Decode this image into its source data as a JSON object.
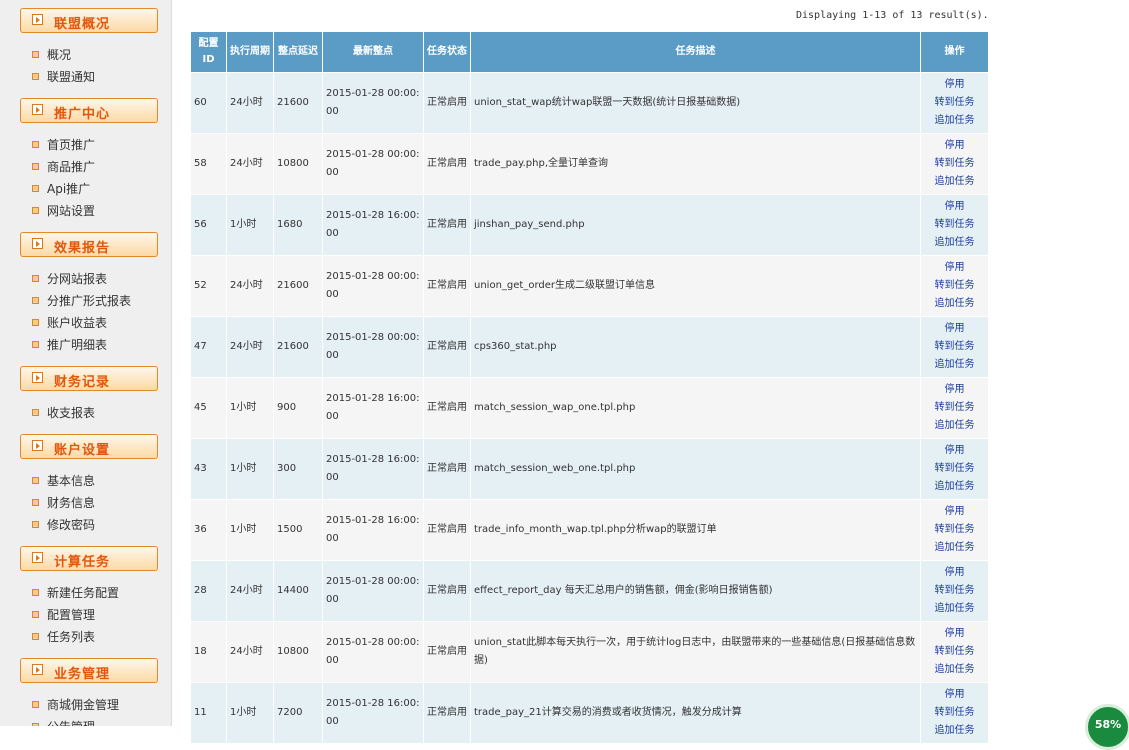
{
  "sidebar": {
    "sections": [
      {
        "title": "联盟概况",
        "items": [
          "概况",
          "联盟通知"
        ]
      },
      {
        "title": "推广中心",
        "items": [
          "首页推广",
          "商品推广",
          "Api推广",
          "网站设置"
        ]
      },
      {
        "title": "效果报告",
        "items": [
          "分网站报表",
          "分推广形式报表",
          "账户收益表",
          "推广明细表"
        ]
      },
      {
        "title": "财务记录",
        "items": [
          "收支报表"
        ]
      },
      {
        "title": "账户设置",
        "items": [
          "基本信息",
          "财务信息",
          "修改密码"
        ]
      },
      {
        "title": "计算任务",
        "items": [
          "新建任务配置",
          "配置管理",
          "任务列表"
        ]
      },
      {
        "title": "业务管理",
        "items": [
          "商城佣金管理",
          "公告管理"
        ]
      }
    ]
  },
  "display_count": "Displaying 1-13 of 13 result(s).",
  "table": {
    "headers": [
      "配置ID",
      "执行周期",
      "整点延迟",
      "最新整点",
      "任务状态",
      "任务描述",
      "操作"
    ],
    "ops": [
      "停用",
      "转到任务",
      "追加任务"
    ],
    "rows": [
      {
        "id": "60",
        "cycle": "24小时",
        "delay": "21600",
        "time": "2015-01-28 00:00:00",
        "status": "正常启用",
        "desc": "union_stat_wap统计wap联盟一天数据(统计日报基础数据)"
      },
      {
        "id": "58",
        "cycle": "24小时",
        "delay": "10800",
        "time": "2015-01-28 00:00:00",
        "status": "正常启用",
        "desc": "trade_pay.php,全量订单查询"
      },
      {
        "id": "56",
        "cycle": "1小时",
        "delay": "1680",
        "time": "2015-01-28 16:00:00",
        "status": "正常启用",
        "desc": "jinshan_pay_send.php"
      },
      {
        "id": "52",
        "cycle": "24小时",
        "delay": "21600",
        "time": "2015-01-28 00:00:00",
        "status": "正常启用",
        "desc": "union_get_order生成二级联盟订单信息"
      },
      {
        "id": "47",
        "cycle": "24小时",
        "delay": "21600",
        "time": "2015-01-28 00:00:00",
        "status": "正常启用",
        "desc": "cps360_stat.php"
      },
      {
        "id": "45",
        "cycle": "1小时",
        "delay": "900",
        "time": "2015-01-28 16:00:00",
        "status": "正常启用",
        "desc": "match_session_wap_one.tpl.php"
      },
      {
        "id": "43",
        "cycle": "1小时",
        "delay": "300",
        "time": "2015-01-28 16:00:00",
        "status": "正常启用",
        "desc": "match_session_web_one.tpl.php"
      },
      {
        "id": "36",
        "cycle": "1小时",
        "delay": "1500",
        "time": "2015-01-28 16:00:00",
        "status": "正常启用",
        "desc": "trade_info_month_wap.tpl.php分析wap的联盟订单"
      },
      {
        "id": "28",
        "cycle": "24小时",
        "delay": "14400",
        "time": "2015-01-28 00:00:00",
        "status": "正常启用",
        "desc": "effect_report_day 每天汇总用户的销售额，佣金(影响日报销售额)"
      },
      {
        "id": "18",
        "cycle": "24小时",
        "delay": "10800",
        "time": "2015-01-28 00:00:00",
        "status": "正常启用",
        "desc": "union_stat此脚本每天执行一次，用于统计log日志中，由联盟带来的一些基础信息(日报基础信息数据)"
      },
      {
        "id": "11",
        "cycle": "1小时",
        "delay": "7200",
        "time": "2015-01-28 16:00:00",
        "status": "正常启用",
        "desc": "trade_pay_21计算交易的消费或者收货情况，触发分成计算"
      }
    ]
  },
  "progress_badge": "58%"
}
